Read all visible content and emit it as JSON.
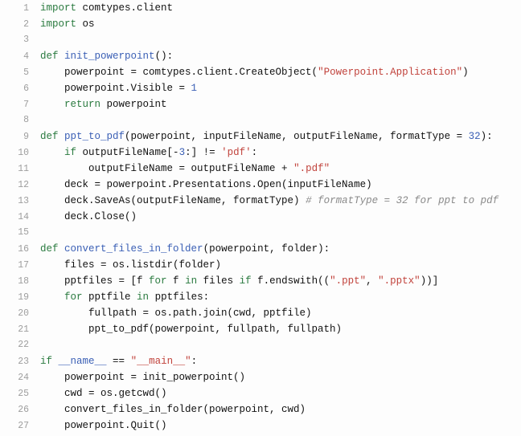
{
  "lines": [
    {
      "n": 1,
      "segs": [
        [
          "k",
          "import"
        ],
        [
          "",
          " comtypes.client"
        ]
      ]
    },
    {
      "n": 2,
      "segs": [
        [
          "k",
          "import"
        ],
        [
          "",
          " os"
        ]
      ]
    },
    {
      "n": 3,
      "segs": [
        [
          "",
          ""
        ]
      ]
    },
    {
      "n": 4,
      "segs": [
        [
          "k",
          "def"
        ],
        [
          "",
          " "
        ],
        [
          "fn",
          "init_powerpoint"
        ],
        [
          "",
          "():"
        ]
      ]
    },
    {
      "n": 5,
      "segs": [
        [
          "",
          "    powerpoint = comtypes.client.CreateObject("
        ],
        [
          "str",
          "\"Powerpoint.Application\""
        ],
        [
          "",
          ")"
        ]
      ]
    },
    {
      "n": 6,
      "segs": [
        [
          "",
          "    powerpoint.Visible = "
        ],
        [
          "num",
          "1"
        ]
      ]
    },
    {
      "n": 7,
      "segs": [
        [
          "",
          "    "
        ],
        [
          "k",
          "return"
        ],
        [
          "",
          " powerpoint"
        ]
      ]
    },
    {
      "n": 8,
      "segs": [
        [
          "",
          ""
        ]
      ]
    },
    {
      "n": 9,
      "segs": [
        [
          "k",
          "def"
        ],
        [
          "",
          " "
        ],
        [
          "fn",
          "ppt_to_pdf"
        ],
        [
          "",
          "(powerpoint, inputFileName, outputFileName, formatType = "
        ],
        [
          "num",
          "32"
        ],
        [
          "",
          "):"
        ]
      ]
    },
    {
      "n": 10,
      "segs": [
        [
          "",
          "    "
        ],
        [
          "k",
          "if"
        ],
        [
          "",
          " outputFileName[-"
        ],
        [
          "num",
          "3"
        ],
        [
          "",
          ":] != "
        ],
        [
          "str",
          "'pdf'"
        ],
        [
          "",
          ":"
        ]
      ]
    },
    {
      "n": 11,
      "segs": [
        [
          "",
          "        outputFileName = outputFileName + "
        ],
        [
          "str",
          "\".pdf\""
        ]
      ]
    },
    {
      "n": 12,
      "segs": [
        [
          "",
          "    deck = powerpoint.Presentations.Open(inputFileName)"
        ]
      ]
    },
    {
      "n": 13,
      "segs": [
        [
          "",
          "    deck.SaveAs(outputFileName, formatType) "
        ],
        [
          "cmt",
          "# formatType = 32 for ppt to pdf"
        ]
      ]
    },
    {
      "n": 14,
      "segs": [
        [
          "",
          "    deck.Close()"
        ]
      ]
    },
    {
      "n": 15,
      "segs": [
        [
          "",
          ""
        ]
      ]
    },
    {
      "n": 16,
      "segs": [
        [
          "k",
          "def"
        ],
        [
          "",
          " "
        ],
        [
          "fn",
          "convert_files_in_folder"
        ],
        [
          "",
          "(powerpoint, folder):"
        ]
      ]
    },
    {
      "n": 17,
      "segs": [
        [
          "",
          "    files = os.listdir(folder)"
        ]
      ]
    },
    {
      "n": 18,
      "segs": [
        [
          "",
          "    pptfiles = [f "
        ],
        [
          "k",
          "for"
        ],
        [
          "",
          " f "
        ],
        [
          "k",
          "in"
        ],
        [
          "",
          " files "
        ],
        [
          "k",
          "if"
        ],
        [
          "",
          " f.endswith(("
        ],
        [
          "str",
          "\".ppt\""
        ],
        [
          "",
          ", "
        ],
        [
          "str",
          "\".pptx\""
        ],
        [
          "",
          "))]"
        ]
      ]
    },
    {
      "n": 19,
      "segs": [
        [
          "",
          "    "
        ],
        [
          "k",
          "for"
        ],
        [
          "",
          " pptfile "
        ],
        [
          "k",
          "in"
        ],
        [
          "",
          " pptfiles:"
        ]
      ]
    },
    {
      "n": 20,
      "segs": [
        [
          "",
          "        fullpath = os.path.join(cwd, pptfile)"
        ]
      ]
    },
    {
      "n": 21,
      "segs": [
        [
          "",
          "        ppt_to_pdf(powerpoint, fullpath, fullpath)"
        ]
      ]
    },
    {
      "n": 22,
      "segs": [
        [
          "",
          ""
        ]
      ]
    },
    {
      "n": 23,
      "segs": [
        [
          "k",
          "if"
        ],
        [
          "",
          " "
        ],
        [
          "sp",
          "__name__"
        ],
        [
          "",
          " == "
        ],
        [
          "str",
          "\"__main__\""
        ],
        [
          "",
          ":"
        ]
      ]
    },
    {
      "n": 24,
      "segs": [
        [
          "",
          "    powerpoint = init_powerpoint()"
        ]
      ]
    },
    {
      "n": 25,
      "segs": [
        [
          "",
          "    cwd = os.getcwd()"
        ]
      ]
    },
    {
      "n": 26,
      "segs": [
        [
          "",
          "    convert_files_in_folder(powerpoint, cwd)"
        ]
      ]
    },
    {
      "n": 27,
      "segs": [
        [
          "",
          "    powerpoint.Quit()"
        ]
      ]
    }
  ]
}
